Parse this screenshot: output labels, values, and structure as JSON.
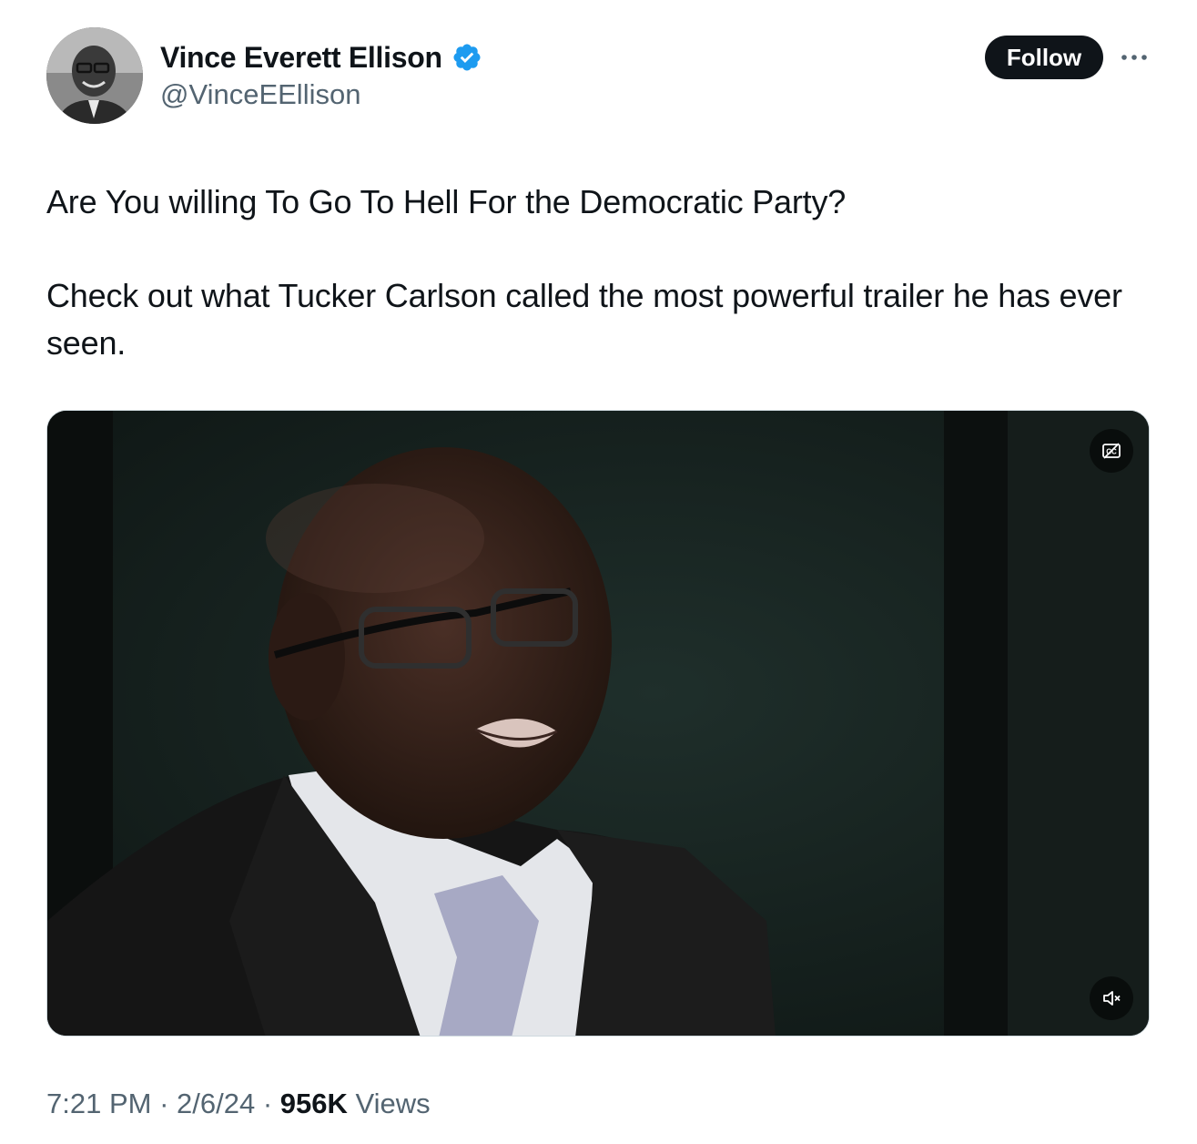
{
  "author": {
    "display_name": "Vince Everett Ellison",
    "handle": "@VinceEEllison",
    "avatar_icon": "profile-photo",
    "verified_icon": "verified-badge-icon",
    "verified_color": "#1d9bf0"
  },
  "actions": {
    "follow_label": "Follow",
    "more_icon": "more-options-icon"
  },
  "tweet": {
    "paragraphs": [
      "Are You willing To Go To Hell For the Democratic Party?",
      "Check out what Tucker Carlson called the most powerful trailer he has ever seen."
    ]
  },
  "video": {
    "captions_icon": "captions-off-icon",
    "mute_icon": "muted-speaker-icon"
  },
  "meta": {
    "time": "7:21 PM",
    "separator": " · ",
    "date": "2/6/24",
    "views_count": "956K",
    "views_label": " Views"
  },
  "colors": {
    "text_primary": "#0f1419",
    "text_secondary": "#536471",
    "follow_bg": "#0f1419",
    "accent": "#1d9bf0"
  }
}
